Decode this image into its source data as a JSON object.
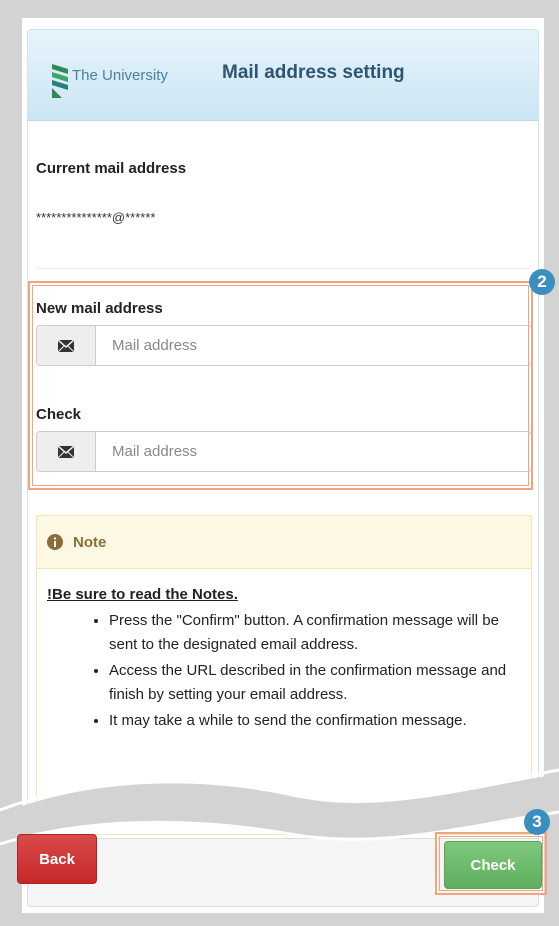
{
  "header": {
    "university_name": "The University",
    "title": "Mail address setting"
  },
  "current": {
    "label": "Current mail address",
    "masked_address": "***************@******"
  },
  "new_mail": {
    "label": "New mail address",
    "placeholder": "Mail address"
  },
  "check_mail": {
    "label": "Check",
    "placeholder": "Mail address"
  },
  "note": {
    "title": "Note",
    "read_notice": "!Be sure to read the Notes.",
    "items": [
      "Press the \"Confirm\" button. A confirmation message will be sent to the designated email address.",
      "Access the URL described in the confirmation message and finish by setting your email address.",
      "It may take a while to send the confirmation message."
    ]
  },
  "buttons": {
    "back_label": "Back",
    "check_label": "Check"
  },
  "callouts": {
    "step_2": "2",
    "step_3": "3"
  },
  "colors": {
    "highlight": "#f0a57d",
    "badge": "#3b8fbf",
    "back_button": "#c62828",
    "check_button": "#6dba6d"
  }
}
